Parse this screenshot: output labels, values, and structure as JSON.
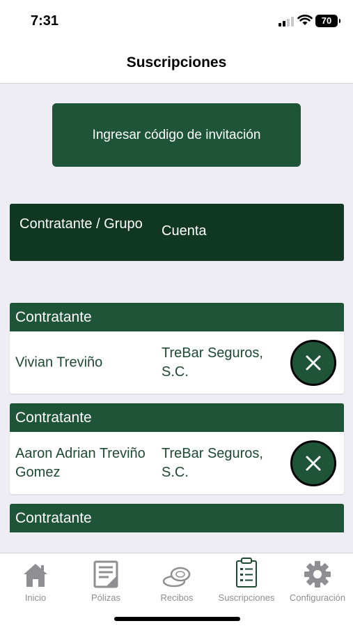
{
  "status_bar": {
    "time": "7:31",
    "battery": "70"
  },
  "nav": {
    "title": "Suscripciones"
  },
  "invite_button": {
    "label": "Ingresar código de invitación"
  },
  "table_header": {
    "col1": "Contratante / Grupo",
    "col2": "Cuenta"
  },
  "subscriptions": [
    {
      "type": "Contratante",
      "name": "Vivian Treviño",
      "account": "TreBar Seguros, S.C."
    },
    {
      "type": "Contratante",
      "name": "Aaron Adrian Treviño Gomez",
      "account": "TreBar Seguros, S.C."
    },
    {
      "type": "Contratante",
      "name": "",
      "account": ""
    }
  ],
  "tabs": [
    {
      "label": "Inicio",
      "icon": "home-icon",
      "active": false
    },
    {
      "label": "Pólizas",
      "icon": "policies-icon",
      "active": false
    },
    {
      "label": "Recibos",
      "icon": "receipts-icon",
      "active": false
    },
    {
      "label": "Suscripciones",
      "icon": "clipboard-icon",
      "active": true
    },
    {
      "label": "Configuración",
      "icon": "gear-icon",
      "active": false
    }
  ],
  "colors": {
    "primary": "#1e5438",
    "header_dark": "#0f3722",
    "text_green": "#1e4a32",
    "inactive": "#8e8e93"
  }
}
